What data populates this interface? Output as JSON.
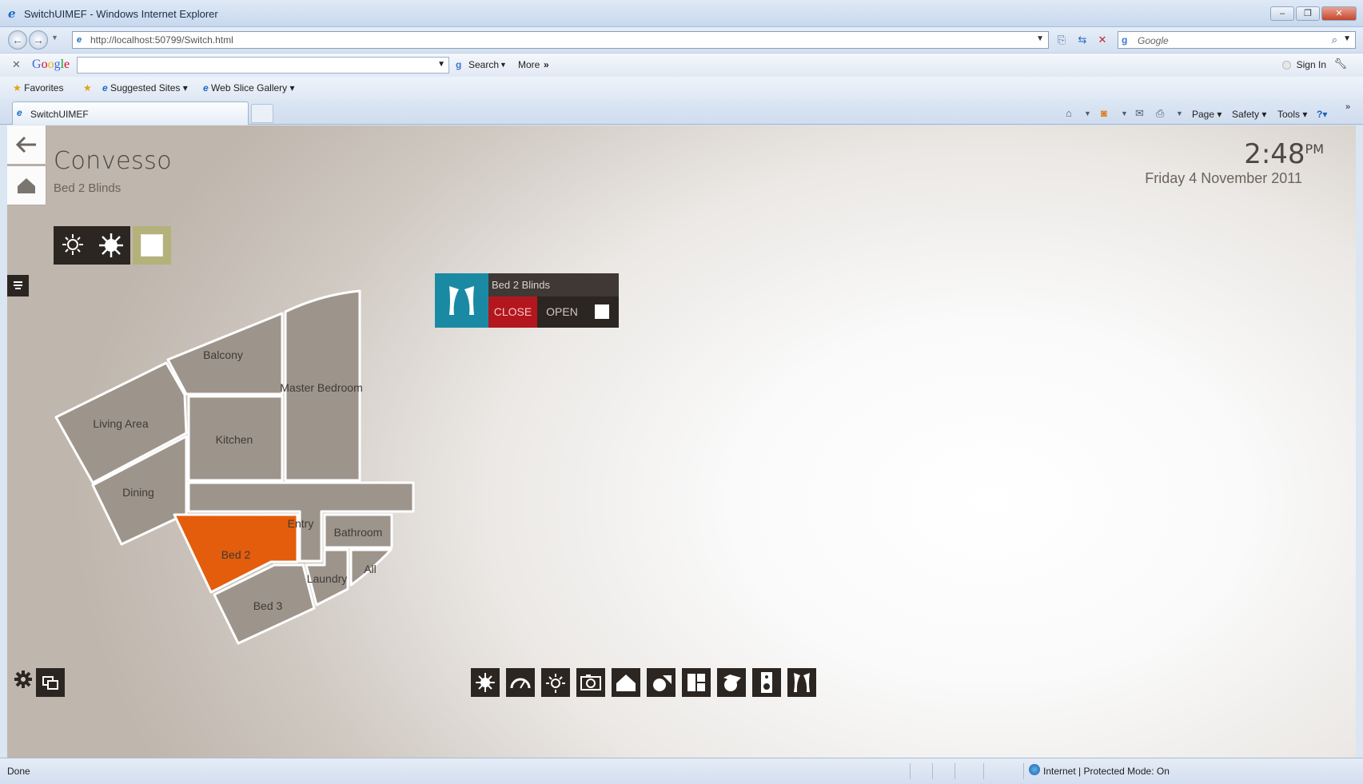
{
  "window": {
    "title": "SwitchUIMEF - Windows Internet Explorer",
    "url": "http://localhost:50799/Switch.html",
    "search_placeholder": "Google"
  },
  "google_toolbar": {
    "search_label": "Search",
    "more_label": "More",
    "signin_label": "Sign In"
  },
  "favorites_bar": {
    "favorites_label": "Favorites",
    "suggested_label": "Suggested Sites",
    "webslice_label": "Web Slice Gallery"
  },
  "tab": {
    "label": "SwitchUIMEF"
  },
  "command_bar": {
    "page_label": "Page",
    "safety_label": "Safety",
    "tools_label": "Tools"
  },
  "app": {
    "brand": "Convesso",
    "subtitle": "Bed 2 Blinds",
    "time": "2:48",
    "ampm": "PM",
    "date": "Friday 4 November 2011",
    "accent_color": "#e35d0c",
    "rooms": {
      "balcony": "Balcony",
      "master_bedroom": "Master Bedroom",
      "living_area": "Living Area",
      "kitchen": "Kitchen",
      "dining": "Dining",
      "entry": "Entry",
      "bathroom": "Bathroom",
      "bed2": "Bed 2",
      "laundry": "Laundry",
      "all": "All",
      "bed3": "Bed 3"
    },
    "selected_room": "Bed 2",
    "widget": {
      "title": "Bed 2 Blinds",
      "close_label": "CLOSE",
      "open_label": "OPEN",
      "state": "CLOSE"
    },
    "bottom_icons": [
      "climate-icon",
      "gauge-icon",
      "light-icon",
      "camera-icon",
      "home-icon",
      "shapes-icon",
      "layout-icon",
      "shapes-alt-icon",
      "speaker-icon",
      "curtains-icon"
    ]
  },
  "status": {
    "left": "Done",
    "zone": "Internet | Protected Mode: On"
  }
}
